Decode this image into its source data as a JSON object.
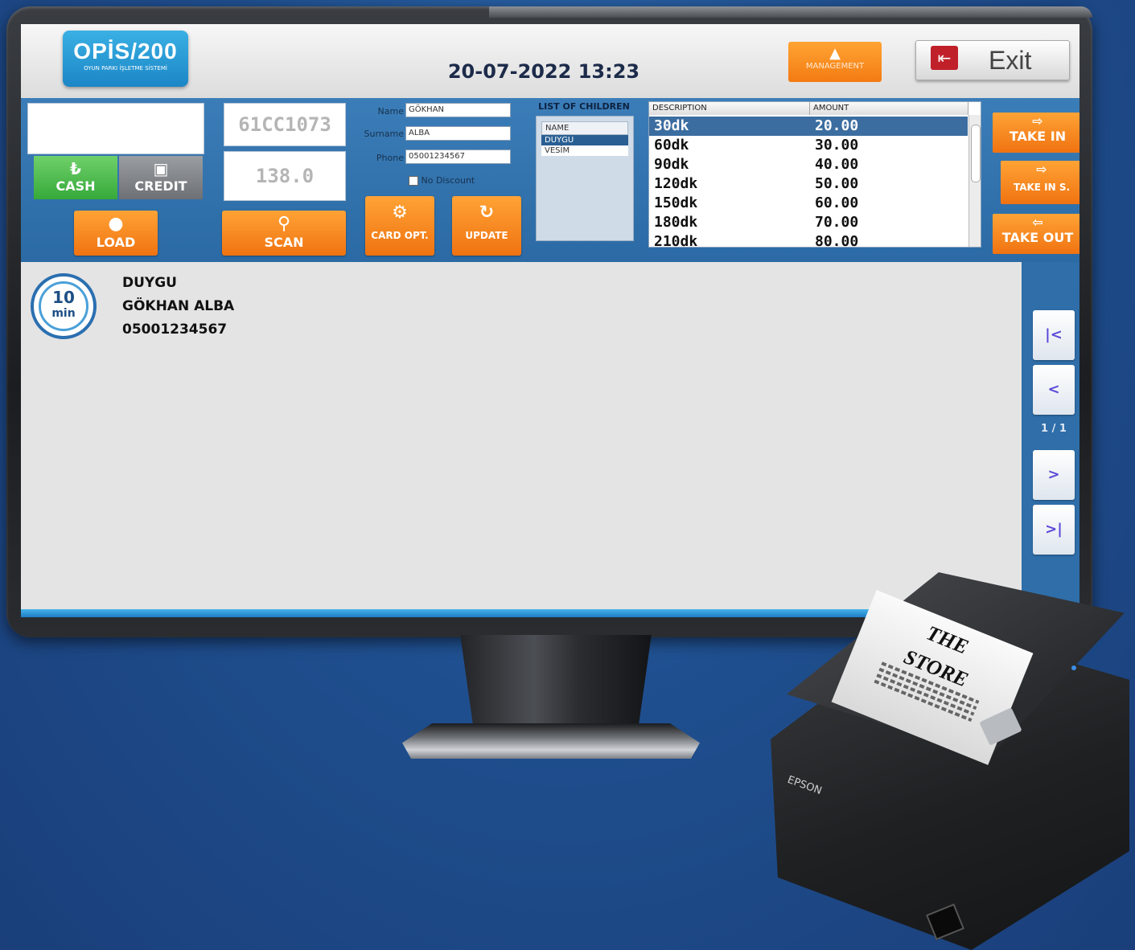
{
  "header": {
    "logo_brand": "OPİS/200",
    "logo_tagline": "OYUN PARKI İŞLETME SİSTEMİ",
    "datetime": "20-07-2022 13:23",
    "management_label": "MANAGEMENT",
    "exit_label": "Exit"
  },
  "card": {
    "number": "61CC1073",
    "balance": "138.0"
  },
  "payment": {
    "cash_label": "CASH",
    "credit_label": "CREDIT"
  },
  "actions": {
    "load_label": "LOAD",
    "scan_label": "SCAN",
    "card_opt_label": "CARD OPT.",
    "update_label": "UPDATE"
  },
  "customer": {
    "name_label": "Name",
    "name_value": "GÖKHAN",
    "surname_label": "Surname",
    "surname_value": "ALBA",
    "phone_label": "Phone",
    "phone_value": "05001234567",
    "no_discount_label": "No Discount"
  },
  "children": {
    "title": "LIST OF CHILDREN",
    "header": "NAME",
    "items": [
      "DUYGU",
      "VESİM"
    ]
  },
  "price_table": {
    "col_description": "DESCRIPTION",
    "col_amount": "AMOUNT",
    "rows": [
      {
        "description": "30dk",
        "amount": "20.00"
      },
      {
        "description": "60dk",
        "amount": "30.00"
      },
      {
        "description": "90dk",
        "amount": "40.00"
      },
      {
        "description": "120dk",
        "amount": "50.00"
      },
      {
        "description": "150dk",
        "amount": "60.00"
      },
      {
        "description": "180dk",
        "amount": "70.00"
      },
      {
        "description": "210dk",
        "amount": "80.00"
      }
    ]
  },
  "side_actions": {
    "take_in": "TAKE IN",
    "take_in_s": "TAKE IN S.",
    "take_out": "TAKE OUT"
  },
  "session": {
    "timer_value": "10",
    "timer_unit": "min",
    "child_name": "DUYGU",
    "parent_name": "GÖKHAN ALBA",
    "phone": "05001234567"
  },
  "pager": {
    "first": "|<",
    "prev": "<",
    "indicator": "1 / 1",
    "next": ">",
    "last": ">|"
  },
  "printer": {
    "brand": "EPSON",
    "receipt_title_1": "THE",
    "receipt_title_2": "STORE"
  },
  "colors": {
    "accent_orange": "#f37b13",
    "cash_green": "#48b84a",
    "credit_gray": "#7a7d82",
    "header_blue": "#2c6ea8"
  }
}
